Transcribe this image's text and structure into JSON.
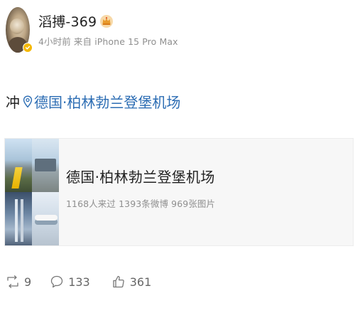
{
  "post": {
    "username": "滔搏-369",
    "meta_line": "4小时前 来自 iPhone 15 Pro Max",
    "text": "冲",
    "location_link": "德国·柏林勃兰登堡机场"
  },
  "location_card": {
    "title": "德国·柏林勃兰登堡机场",
    "stats": "1168人来过 1393条微博 969张图片"
  },
  "actions": {
    "repost_count": "9",
    "comment_count": "133",
    "like_count": "361"
  },
  "icons": {
    "verify": "verified-badge-icon",
    "crown": "crown-icon",
    "pin": "location-pin-icon",
    "repost": "repost-icon",
    "comment": "comment-icon",
    "like": "like-icon"
  },
  "colors": {
    "link": "#2b6cb3",
    "meta_gray": "#8f8f8f",
    "badge_gold": "#f5b800"
  }
}
